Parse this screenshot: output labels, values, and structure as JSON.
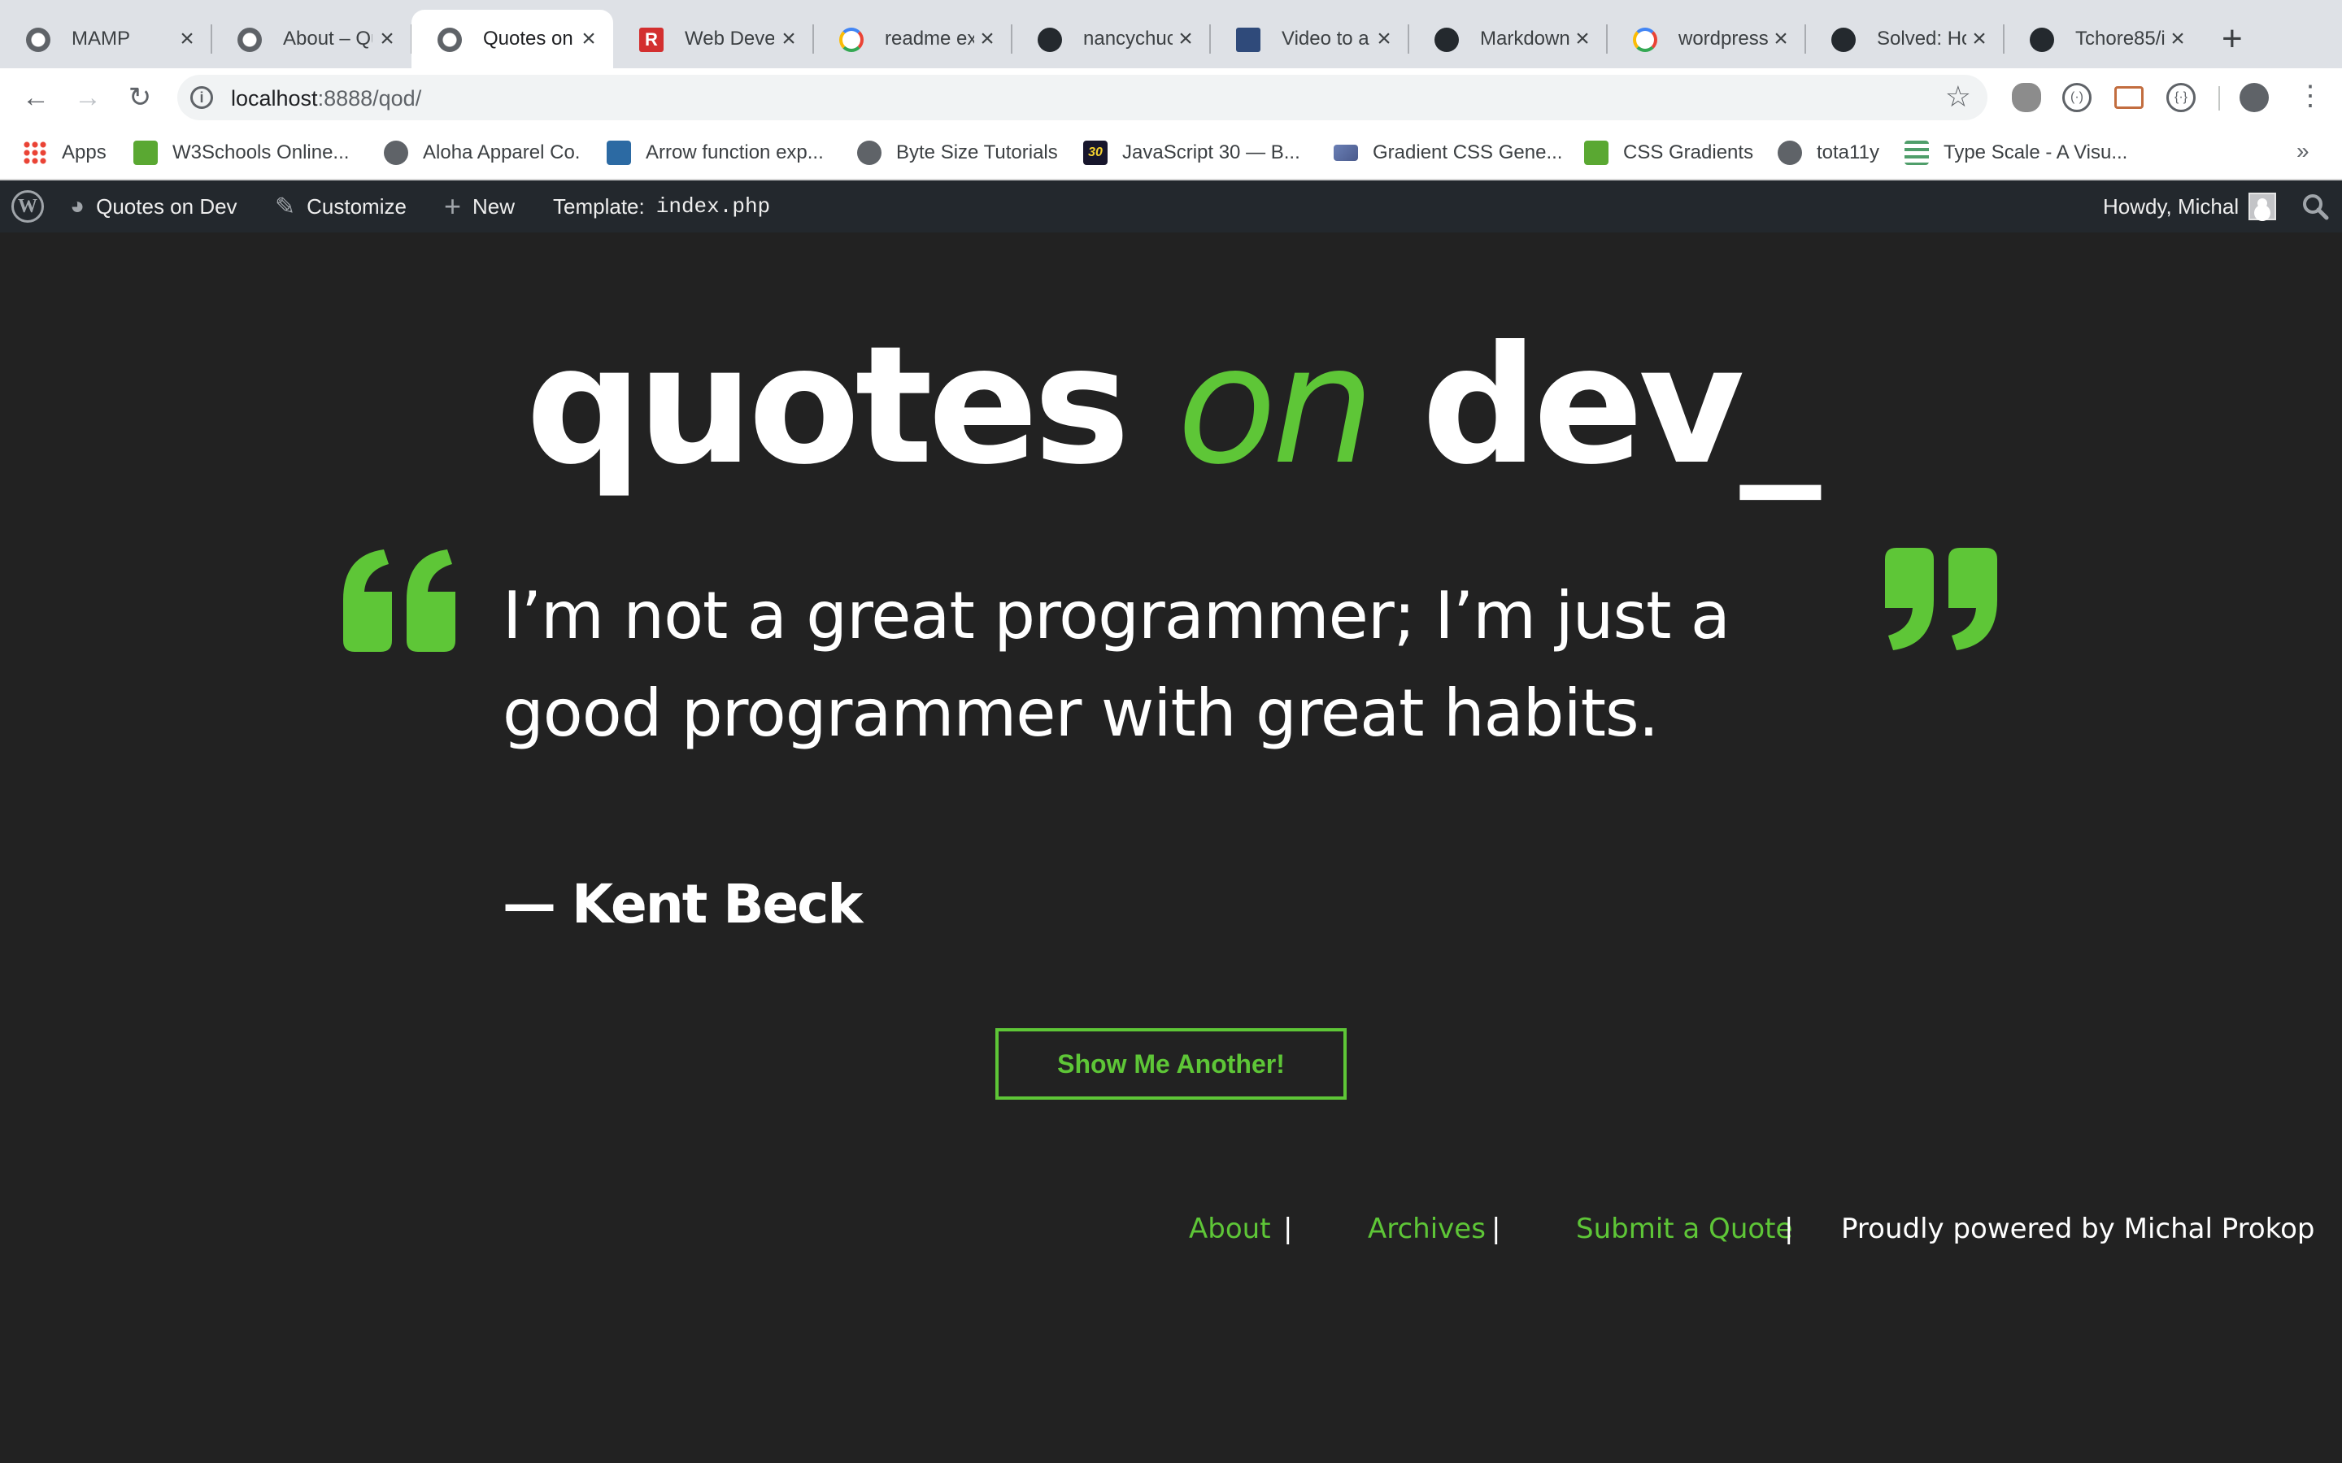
{
  "browser": {
    "tabs": [
      {
        "title": "MAMP",
        "icon": "globe-icon",
        "active": false
      },
      {
        "title": "About – Qu",
        "icon": "globe-icon",
        "active": false
      },
      {
        "title": "Quotes on",
        "icon": "globe-icon",
        "active": true
      },
      {
        "title": "Web Devel",
        "icon": "r-logo-icon",
        "active": false
      },
      {
        "title": "readme ex",
        "icon": "google-icon",
        "active": false
      },
      {
        "title": "nancychuc",
        "icon": "github-icon",
        "active": false
      },
      {
        "title": "Video to a",
        "icon": "video-icon",
        "active": false
      },
      {
        "title": "Markdown",
        "icon": "github-icon",
        "active": false
      },
      {
        "title": "wordpress",
        "icon": "google-icon",
        "active": false
      },
      {
        "title": "Solved: Ho",
        "icon": "github-icon",
        "active": false
      },
      {
        "title": "Tchore85/i",
        "icon": "github-icon",
        "active": false
      }
    ],
    "address": {
      "host": "localhost",
      "rest": ":8888/qod/"
    },
    "bookmarks": [
      {
        "label": "Apps",
        "icon": "apps-grid-icon"
      },
      {
        "label": "W3Schools Online...",
        "icon": "w3schools-icon"
      },
      {
        "label": "Aloha Apparel Co.",
        "icon": "globe-icon"
      },
      {
        "label": "Arrow function exp...",
        "icon": "arrow-bird-icon"
      },
      {
        "label": "Byte Size Tutorials",
        "icon": "globe-icon"
      },
      {
        "label": "JavaScript 30 — B...",
        "icon": "js30-icon"
      },
      {
        "label": "Gradient CSS Gene...",
        "icon": "gradient-icon"
      },
      {
        "label": "CSS Gradients",
        "icon": "w3schools-icon"
      },
      {
        "label": "tota11y",
        "icon": "globe-icon"
      },
      {
        "label": "Type Scale - A Visu...",
        "icon": "type-scale-icon"
      }
    ]
  },
  "adminbar": {
    "site_name": "Quotes on Dev",
    "customize": "Customize",
    "new": "New",
    "template_label": "Template:",
    "template_file": "index.php",
    "howdy": "Howdy, Michal"
  },
  "site": {
    "title_part1": "quotes ",
    "title_part2": "on",
    "title_part3": " dev_"
  },
  "quote": {
    "text": "I’m not a great programmer; I’m just a good programmer with great habits.",
    "author": "— Kent Beck"
  },
  "button": {
    "label": "Show Me Another!"
  },
  "footer": {
    "links": [
      "About",
      "Archives",
      "Submit a Quote"
    ],
    "separator": "|",
    "credit": "Proudly powered by Michal Prokop"
  },
  "colors": {
    "accent": "#5ec637",
    "background": "#222222",
    "adminbar": "#23282d"
  }
}
